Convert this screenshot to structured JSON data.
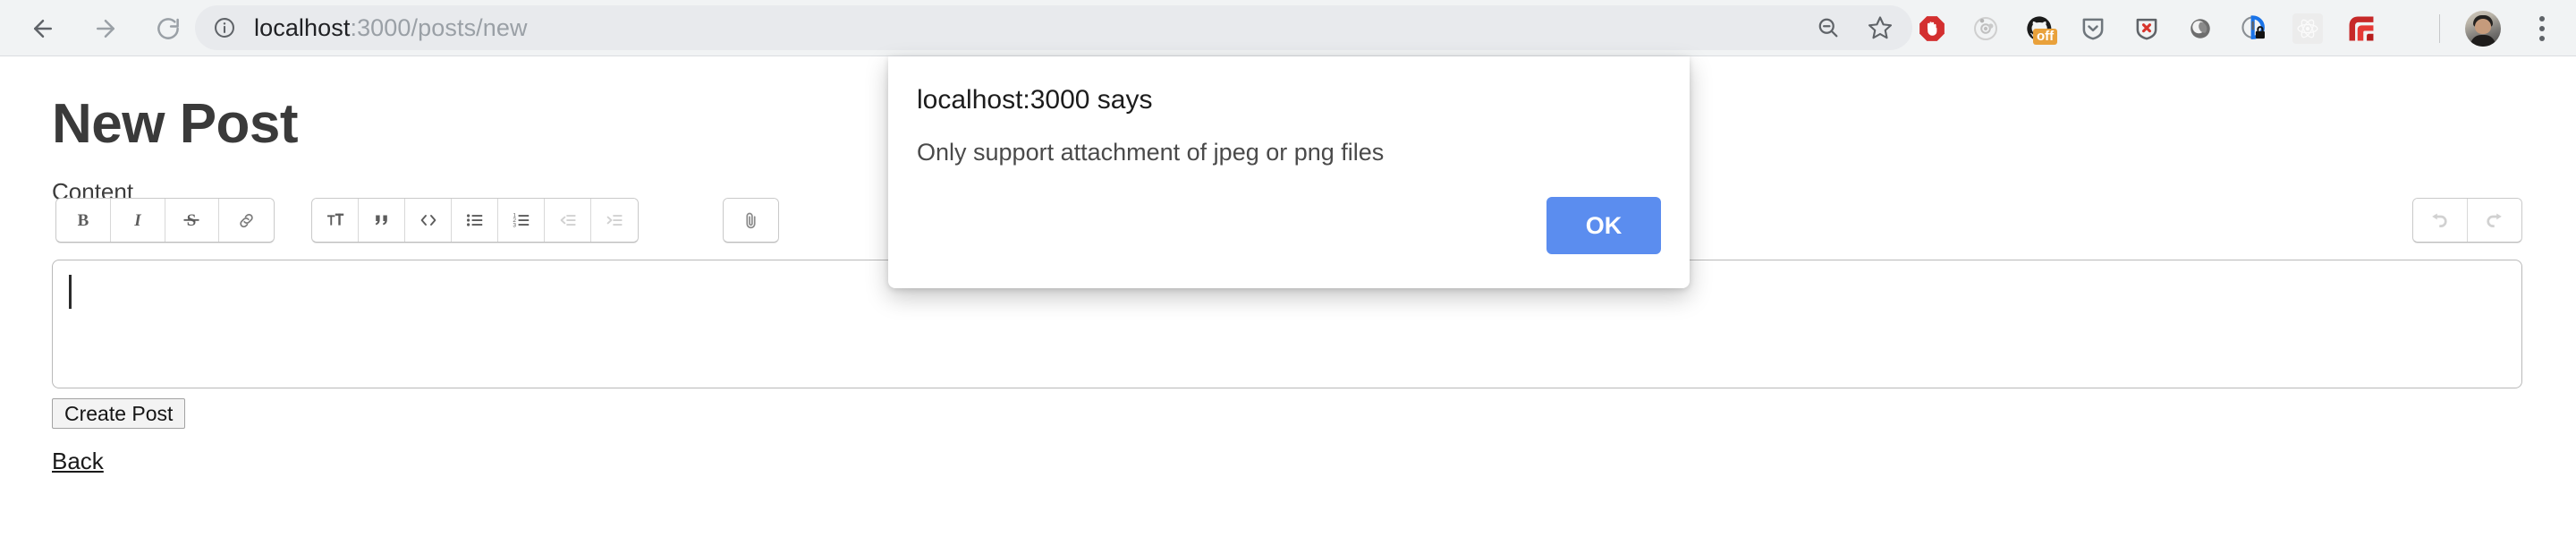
{
  "browser": {
    "back_tooltip": "Back",
    "forward_tooltip": "Forward",
    "reload_tooltip": "Reload",
    "site_info_tooltip": "View site information",
    "url_host": "localhost",
    "url_path": ":3000/posts/new",
    "zoom_out_tooltip": "Zoom out",
    "bookmark_tooltip": "Bookmark this tab",
    "profile_tooltip": "Profile",
    "menu_tooltip": "Customize and control Google Chrome",
    "extensions": [
      {
        "name": "adblock-icon",
        "label": "AdBlock",
        "color": "#d32f2f",
        "badge": ""
      },
      {
        "name": "privacy-badger-icon",
        "label": "Privacy Badger",
        "color": "#c9c9c9",
        "badge": ""
      },
      {
        "name": "github-octocat-icon",
        "label": "GitHub",
        "color": "#1b1b1b",
        "badge": "off"
      },
      {
        "name": "shield-check-icon",
        "label": "Password Manager",
        "color": "#6f767c",
        "badge": ""
      },
      {
        "name": "shield-block-icon",
        "label": "Ad Blocker",
        "color": "#5f6368",
        "badge": ""
      },
      {
        "name": "circle-extension-icon",
        "label": "Pocket",
        "color": "#6e6e6e",
        "badge": ""
      },
      {
        "name": "https-lock-icon",
        "label": "HTTPS Everywhere",
        "color": "#1a73e8",
        "badge": ""
      },
      {
        "name": "react-devtools-icon",
        "label": "React Developer Tools",
        "color": "#dcdcdc",
        "badge": ""
      },
      {
        "name": "swirl-extension-icon",
        "label": "Extension",
        "color": "#c62828",
        "badge": ""
      }
    ]
  },
  "page": {
    "title": "New Post",
    "content_label": "Content",
    "editor_value": "",
    "create_post_label": "Create Post",
    "back_label": "Back",
    "toolbar": {
      "bold": "Bold",
      "italic": "Italic",
      "strikethrough": "Strikethrough",
      "link": "Link",
      "heading": "Heading",
      "quote": "Quote",
      "code": "Code",
      "bullet_list": "Bullets",
      "numbered_list": "Numbers",
      "decrease_level": "Decrease Level",
      "increase_level": "Increase Level",
      "attach": "Attach Files",
      "undo": "Undo",
      "redo": "Redo"
    }
  },
  "dialog": {
    "title": "localhost:3000 says",
    "message": "Only support attachment of jpeg or png files",
    "ok_label": "OK",
    "accent_color": "#5b8def"
  }
}
